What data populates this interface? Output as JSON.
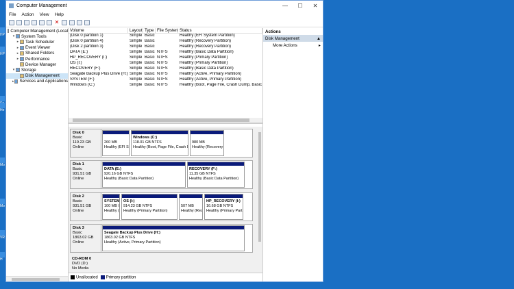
{
  "window": {
    "title": "Computer Management"
  },
  "menu": [
    "File",
    "Action",
    "View",
    "Help"
  ],
  "tree": [
    {
      "label": "Computer Management (Local",
      "depth": 0,
      "expand": "",
      "icon": "computer-icon",
      "sel": false
    },
    {
      "label": "System Tools",
      "depth": 1,
      "expand": "v",
      "icon": "tools-icon",
      "sel": false
    },
    {
      "label": "Task Scheduler",
      "depth": 2,
      "expand": ">",
      "icon": "clock-icon",
      "sel": false
    },
    {
      "label": "Event Viewer",
      "depth": 2,
      "expand": ">",
      "icon": "event-viewer-icon",
      "sel": false
    },
    {
      "label": "Shared Folders",
      "depth": 2,
      "expand": ">",
      "icon": "folder-icon",
      "sel": false
    },
    {
      "label": "Performance",
      "depth": 2,
      "expand": ">",
      "icon": "performance-icon",
      "sel": false
    },
    {
      "label": "Device Manager",
      "depth": 2,
      "expand": "",
      "icon": "device-icon",
      "sel": false
    },
    {
      "label": "Storage",
      "depth": 1,
      "expand": "v",
      "icon": "storage-icon",
      "sel": false
    },
    {
      "label": "Disk Management",
      "depth": 2,
      "expand": "",
      "icon": "disk-icon",
      "sel": true
    },
    {
      "label": "Services and Applications",
      "depth": 1,
      "expand": ">",
      "icon": "services-icon",
      "sel": false
    }
  ],
  "volumes": {
    "headers": [
      "Volume",
      "Layout",
      "Type",
      "File System",
      "Status"
    ],
    "rows": [
      [
        "(Disk 0 partition 1)",
        "Simple",
        "Basic",
        "",
        "Healthy (EFI System Partition)"
      ],
      [
        "(Disk 0 partition 4)",
        "Simple",
        "Basic",
        "",
        "Healthy (Recovery Partition)"
      ],
      [
        "(Disk 2 partition 3)",
        "Simple",
        "Basic",
        "",
        "Healthy (Recovery Partition)"
      ],
      [
        "DATA (E:)",
        "Simple",
        "Basic",
        "NTFS",
        "Healthy (Basic Data Partition)"
      ],
      [
        "HP_RECOVERY (I:)",
        "Simple",
        "Basic",
        "NTFS",
        "Healthy (Primary Partition)"
      ],
      [
        "OS (I:)",
        "Simple",
        "Basic",
        "NTFS",
        "Healthy (Primary Partition)"
      ],
      [
        "RECOVERY (F:)",
        "Simple",
        "Basic",
        "NTFS",
        "Healthy (Basic Data Partition)"
      ],
      [
        "Seagate Backup Plus Drive (H:)",
        "Simple",
        "Basic",
        "NTFS",
        "Healthy (Active, Primary Partition)"
      ],
      [
        "SYSTEM (F:)",
        "Simple",
        "Basic",
        "NTFS",
        "Healthy (Active, Primary Partition)"
      ],
      [
        "Windows (C:)",
        "Simple",
        "Basic",
        "NTFS",
        "Healthy (Boot, Page File, Crash Dump, Basic Da"
      ]
    ]
  },
  "disks": [
    {
      "name": "Disk 0",
      "type": "Basic",
      "size": "119.23 GB",
      "status": "Online",
      "parts": [
        {
          "name": "",
          "size": "260 MB",
          "status": "Healthy (EFI S",
          "w": 40
        },
        {
          "name": "Windows  (C:)",
          "size": "118.01 GB NTFS",
          "status": "Healthy (Boot, Page File, Crash D",
          "w": 84
        },
        {
          "name": "",
          "size": "980 MB",
          "status": "Healthy (Recovery",
          "w": 50
        }
      ]
    },
    {
      "name": "Disk 1",
      "type": "Basic",
      "size": "931.51 GB",
      "status": "Online",
      "parts": [
        {
          "name": "DATA  (E:)",
          "size": "920.16 GB NTFS",
          "status": "Healthy (Basic Data Partition)",
          "w": 122
        },
        {
          "name": "RECOVERY  (F:)",
          "size": "11.35 GB NTFS",
          "status": "Healthy (Basic Data Partition)",
          "w": 84
        }
      ]
    },
    {
      "name": "Disk 2",
      "type": "Basic",
      "size": "931.51 GB",
      "status": "Online",
      "parts": [
        {
          "name": "SYSTEM",
          "size": "100 MB I",
          "status": "Healthy (",
          "w": 26
        },
        {
          "name": "OS  (I:)",
          "size": "914.23 GB NTFS",
          "status": "Healthy (Primary Partition)",
          "w": 82
        },
        {
          "name": "",
          "size": "507 MB",
          "status": "Healthy (Rec",
          "w": 35
        },
        {
          "name": "HP_RECOVERY  (I:)",
          "size": "16.68 GB NTFS",
          "status": "Healthy (Primary Part",
          "w": 57
        }
      ]
    },
    {
      "name": "Disk 3",
      "type": "Basic",
      "size": "1863.02 GB",
      "status": "Online",
      "parts": [
        {
          "name": "Seagate Backup Plus Drive  (H:)",
          "size": "1863.02 GB NTFS",
          "status": "Healthy (Active, Primary Partition)",
          "w": 208
        }
      ]
    },
    {
      "name": "CD-ROM 0",
      "type": "DVD (D:)",
      "size": "",
      "status": "No Media",
      "parts": []
    }
  ],
  "legend": {
    "unallocated": "Unallocated",
    "primary": "Primary partition"
  },
  "actions": {
    "header": "Actions",
    "section": "Disk Management",
    "more": "More Actions"
  },
  "desktop": [
    "HP",
    "HP",
    "Sc",
    "He",
    "Mo",
    "Mo",
    "VR",
    "H"
  ],
  "colors": {
    "desktop": "#1a6fc4",
    "partition_bar": "#0a1a7a"
  }
}
